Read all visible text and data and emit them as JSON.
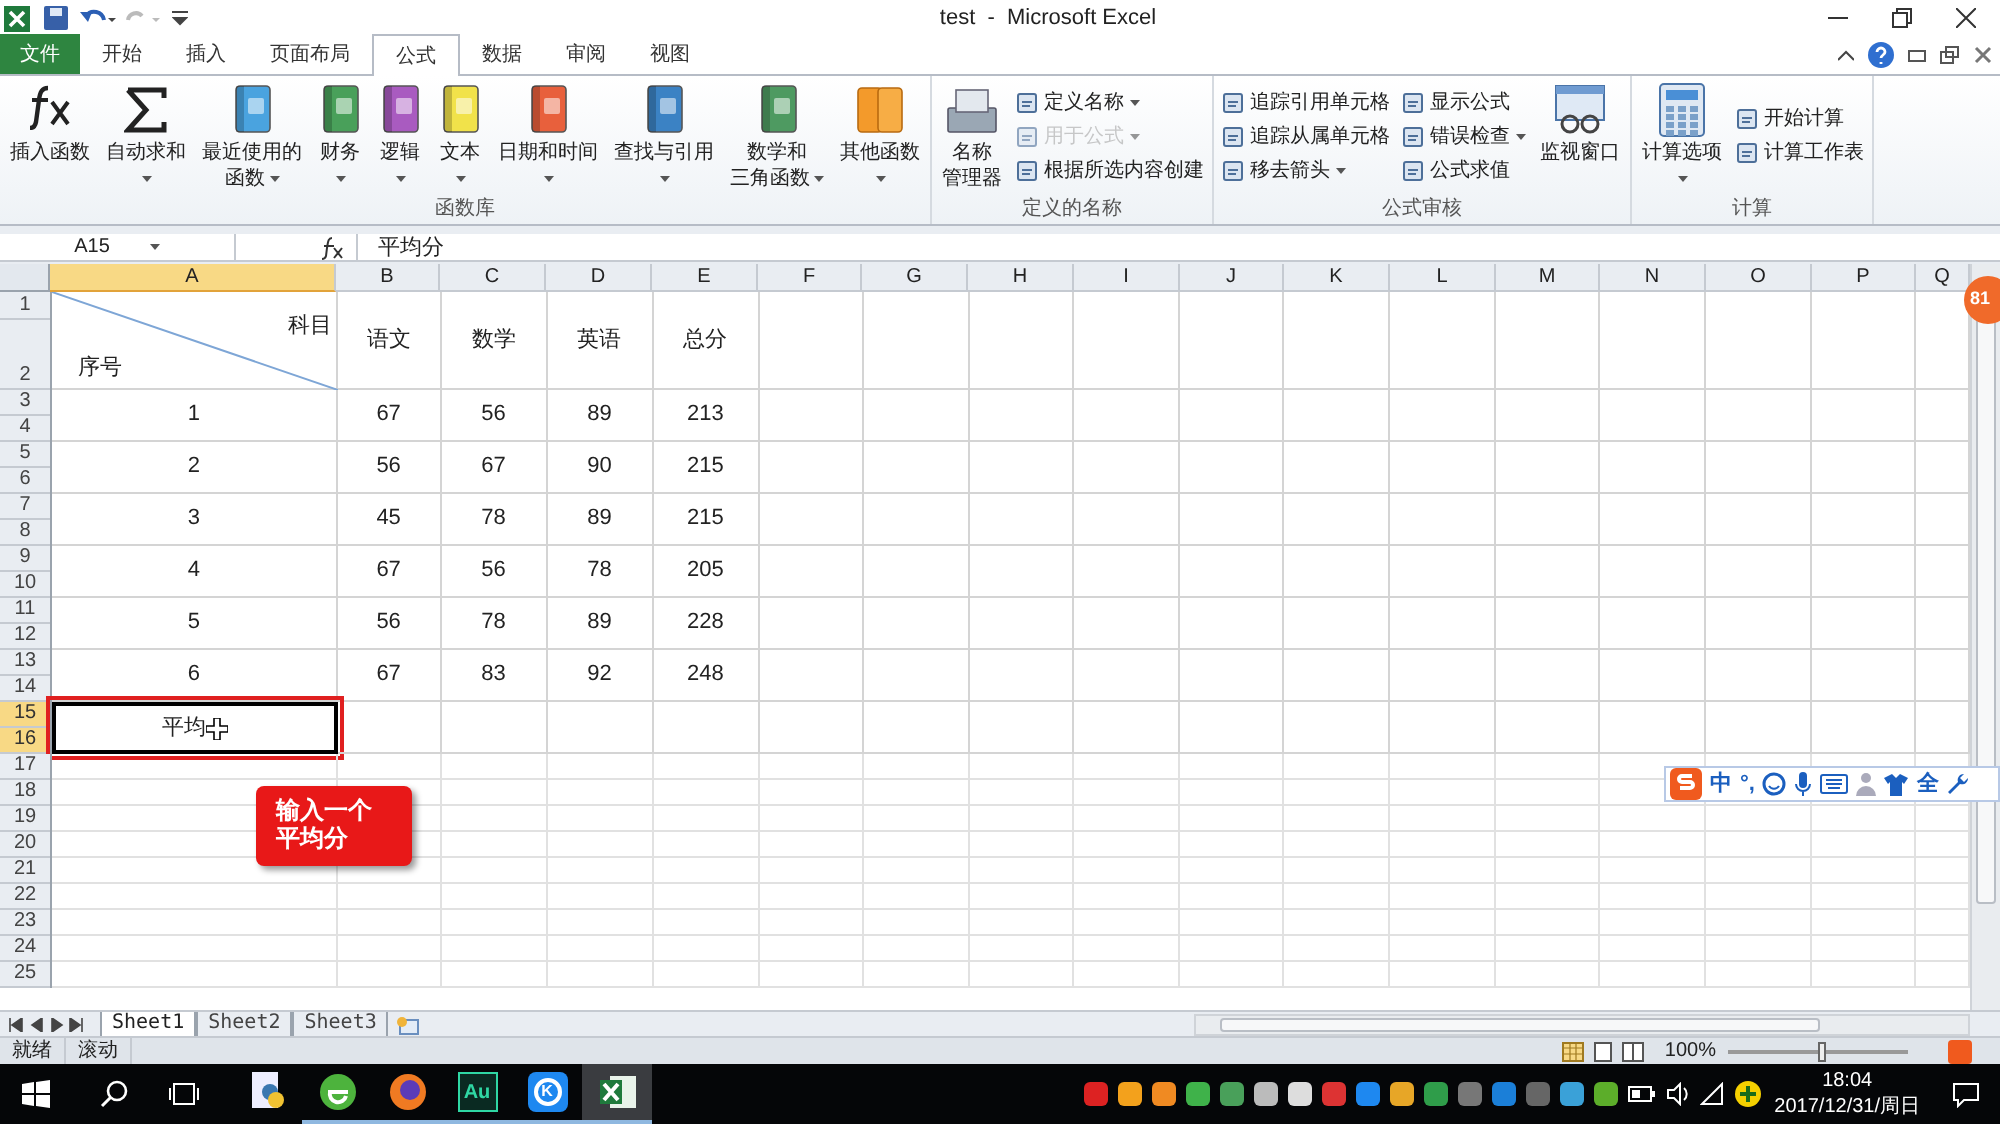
{
  "title_bar": {
    "title": "test  -  Microsoft Excel"
  },
  "tabs": [
    {
      "label": "文件",
      "kind": "file",
      "selected": false
    },
    {
      "label": "开始",
      "kind": "tab",
      "selected": false
    },
    {
      "label": "插入",
      "kind": "tab",
      "selected": false
    },
    {
      "label": "页面布局",
      "kind": "tab",
      "selected": false
    },
    {
      "label": "公式",
      "kind": "tab",
      "selected": true
    },
    {
      "label": "数据",
      "kind": "tab",
      "selected": false
    },
    {
      "label": "审阅",
      "kind": "tab",
      "selected": false
    },
    {
      "label": "视图",
      "kind": "tab",
      "selected": false
    }
  ],
  "ribbon": {
    "groups": [
      {
        "label": "函数库",
        "items": [
          {
            "kind": "large",
            "lines": [
              "插入函数"
            ],
            "dropdown": false
          },
          {
            "kind": "large",
            "lines": [
              "自动求和"
            ],
            "dropdown": true
          },
          {
            "kind": "large",
            "lines": [
              "最近使用的",
              "函数"
            ],
            "dropdown": true
          },
          {
            "kind": "large",
            "lines": [
              "财务"
            ],
            "dropdown": true
          },
          {
            "kind": "large",
            "lines": [
              "逻辑"
            ],
            "dropdown": true
          },
          {
            "kind": "large",
            "lines": [
              "文本"
            ],
            "dropdown": true
          },
          {
            "kind": "large",
            "lines": [
              "日期和时间"
            ],
            "dropdown": true
          },
          {
            "kind": "large",
            "lines": [
              "查找与引用"
            ],
            "dropdown": true
          },
          {
            "kind": "large",
            "lines": [
              "数学和",
              "三角函数"
            ],
            "dropdown": true
          },
          {
            "kind": "large",
            "lines": [
              "其他函数"
            ],
            "dropdown": true
          }
        ]
      },
      {
        "label": "定义的名称",
        "items": [
          {
            "kind": "large",
            "lines": [
              "名称",
              "管理器"
            ],
            "dropdown": false
          },
          {
            "kind": "stack",
            "entries": [
              {
                "label": "定义名称",
                "dropdown": true,
                "disabled": false
              },
              {
                "label": "用于公式",
                "dropdown": true,
                "disabled": true
              },
              {
                "label": "根据所选内容创建",
                "dropdown": false,
                "disabled": false
              }
            ]
          }
        ]
      },
      {
        "label": "公式审核",
        "items": [
          {
            "kind": "stack",
            "entries": [
              {
                "label": "追踪引用单元格",
                "dropdown": false,
                "disabled": false
              },
              {
                "label": "追踪从属单元格",
                "dropdown": false,
                "disabled": false
              },
              {
                "label": "移去箭头",
                "dropdown": true,
                "disabled": false
              }
            ]
          },
          {
            "kind": "stack",
            "entries": [
              {
                "label": "显示公式",
                "dropdown": false,
                "disabled": false
              },
              {
                "label": "错误检查",
                "dropdown": true,
                "disabled": false
              },
              {
                "label": "公式求值",
                "dropdown": false,
                "disabled": false
              }
            ]
          },
          {
            "kind": "large",
            "lines": [
              "监视窗口"
            ],
            "dropdown": false
          }
        ]
      },
      {
        "label": "计算",
        "items": [
          {
            "kind": "large",
            "lines": [
              "计算选项"
            ],
            "dropdown": true
          },
          {
            "kind": "stack",
            "entries": [
              {
                "label": "开始计算",
                "dropdown": false,
                "disabled": false
              },
              {
                "label": "计算工作表",
                "dropdown": false,
                "disabled": false
              }
            ]
          }
        ]
      }
    ]
  },
  "formula_bar": {
    "name_box": "A15",
    "content": "平均分"
  },
  "sheet": {
    "columns": [
      {
        "label": "A",
        "selected": true
      },
      {
        "label": "B",
        "selected": false
      },
      {
        "label": "C",
        "selected": false
      },
      {
        "label": "D",
        "selected": false
      },
      {
        "label": "E",
        "selected": false
      },
      {
        "label": "F",
        "selected": false
      },
      {
        "label": "G",
        "selected": false
      },
      {
        "label": "H",
        "selected": false
      },
      {
        "label": "I",
        "selected": false
      },
      {
        "label": "J",
        "selected": false
      },
      {
        "label": "K",
        "selected": false
      },
      {
        "label": "L",
        "selected": false
      },
      {
        "label": "M",
        "selected": false
      },
      {
        "label": "N",
        "selected": false
      },
      {
        "label": "O",
        "selected": false
      },
      {
        "label": "P",
        "selected": false
      },
      {
        "label": "Q",
        "selected": false
      }
    ],
    "row_numbers": [
      {
        "label": "1",
        "selected": false
      },
      {
        "label": "2",
        "selected": false
      },
      {
        "label": "3",
        "selected": false
      },
      {
        "label": "4",
        "selected": false
      },
      {
        "label": "5",
        "selected": false
      },
      {
        "label": "6",
        "selected": false
      },
      {
        "label": "7",
        "selected": false
      },
      {
        "label": "8",
        "selected": false
      },
      {
        "label": "9",
        "selected": false
      },
      {
        "label": "10",
        "selected": false
      },
      {
        "label": "11",
        "selected": false
      },
      {
        "label": "12",
        "selected": false
      },
      {
        "label": "13",
        "selected": false
      },
      {
        "label": "14",
        "selected": false
      },
      {
        "label": "15",
        "selected": true
      },
      {
        "label": "16",
        "selected": true
      },
      {
        "label": "17",
        "selected": false
      },
      {
        "label": "18",
        "selected": false
      },
      {
        "label": "19",
        "selected": false
      },
      {
        "label": "20",
        "selected": false
      },
      {
        "label": "21",
        "selected": false
      },
      {
        "label": "22",
        "selected": false
      },
      {
        "label": "23",
        "selected": false
      },
      {
        "label": "24",
        "selected": false
      },
      {
        "label": "25",
        "selected": false
      }
    ],
    "records": [
      {
        "kind": "diagonal",
        "top_right": "科目",
        "bottom_left": "序号",
        "cells": [
          "语文",
          "数学",
          "英语",
          "总分"
        ]
      },
      {
        "kind": "data",
        "cells": [
          "1",
          "67",
          "56",
          "89",
          "213"
        ]
      },
      {
        "kind": "data",
        "cells": [
          "2",
          "56",
          "67",
          "90",
          "215"
        ]
      },
      {
        "kind": "data",
        "cells": [
          "3",
          "45",
          "78",
          "89",
          "215"
        ]
      },
      {
        "kind": "data",
        "cells": [
          "4",
          "67",
          "56",
          "78",
          "205"
        ]
      },
      {
        "kind": "data",
        "cells": [
          "5",
          "56",
          "78",
          "89",
          "228"
        ]
      },
      {
        "kind": "data",
        "cells": [
          "6",
          "67",
          "83",
          "92",
          "248"
        ]
      },
      {
        "kind": "editing",
        "cells": [
          "平均"
        ]
      }
    ],
    "sheet_tabs": [
      {
        "label": "Sheet1",
        "selected": true
      },
      {
        "label": "Sheet2",
        "selected": false
      },
      {
        "label": "Sheet3",
        "selected": false
      }
    ]
  },
  "callout": {
    "text": "输入一个平均分"
  },
  "badge": "81",
  "ime_bar": {
    "mode": "中",
    "punctuation": "°,",
    "width": "全"
  },
  "status_bar": {
    "items": [
      "就绪",
      "滚动"
    ],
    "zoom": "100%",
    "zoom_slider": {
      "level": 0.5
    }
  },
  "taskbar": {
    "apps": [
      {
        "kind": "python",
        "running": false,
        "selected": false
      },
      {
        "kind": "browser",
        "running": true,
        "selected": false
      },
      {
        "kind": "firefox",
        "running": true,
        "selected": false
      },
      {
        "kind": "au",
        "label": "Au",
        "running": true,
        "selected": false
      },
      {
        "kind": "k",
        "label": "K",
        "running": true,
        "selected": false
      },
      {
        "kind": "excel",
        "running": true,
        "selected": true
      }
    ],
    "time": "18:04",
    "date": "2017/12/31/周日"
  }
}
